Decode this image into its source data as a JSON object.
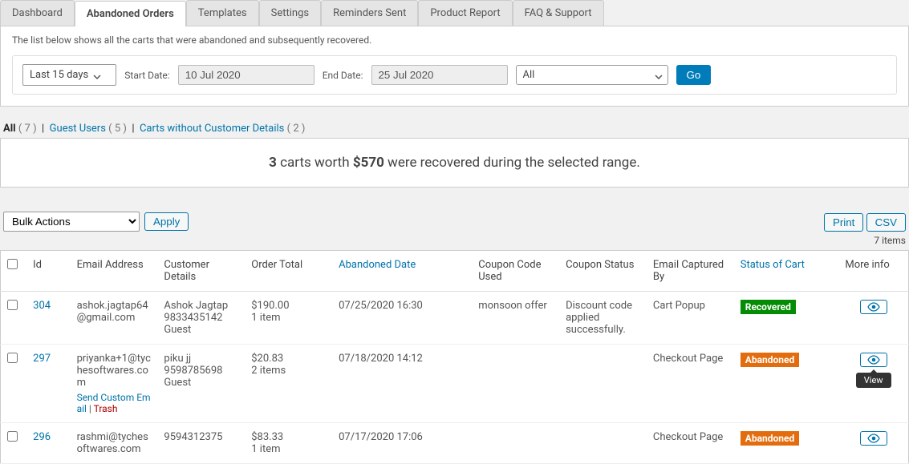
{
  "tabs": [
    "Dashboard",
    "Abandoned Orders",
    "Templates",
    "Settings",
    "Reminders Sent",
    "Product Report",
    "FAQ & Support"
  ],
  "active_tab": "Abandoned Orders",
  "intro": "The list below shows all the carts that were abandoned and subsequently recovered.",
  "filters": {
    "range_label": "Last 15 days",
    "start_label": "Start Date:",
    "start_value": "10 Jul 2020",
    "end_label": "End Date:",
    "end_value": "25 Jul 2020",
    "segment_value": "All",
    "go_label": "Go"
  },
  "subfilters": {
    "all_label": "All",
    "all_count": "( 7 )",
    "guest_label": "Guest Users",
    "guest_count": "( 5 )",
    "nocust_label": "Carts without Customer Details",
    "nocust_count": "( 2 )"
  },
  "summary": {
    "count_bold": "3",
    "mid_text": " carts worth ",
    "amount_bold": "$570",
    "rest": " were recovered during the selected range."
  },
  "actions": {
    "bulk_label": "Bulk Actions",
    "apply_label": "Apply",
    "print_label": "Print",
    "csv_label": "CSV",
    "items_label": "7 items"
  },
  "columns": {
    "cb": "",
    "id": "Id",
    "email": "Email Address",
    "customer": "Customer Details",
    "total": "Order Total",
    "date": "Abandoned Date",
    "coupon_used": "Coupon Code Used",
    "coupon_status": "Coupon Status",
    "captured": "Email Captured By",
    "status": "Status of Cart",
    "more": "More info"
  },
  "rows": [
    {
      "id": "304",
      "email": "ashok.jagtap64@gmail.com",
      "customer_lines": [
        "Ashok Jagtap",
        "9833435142",
        "Guest"
      ],
      "total_lines": [
        "$190.00",
        "1 item"
      ],
      "date": "07/25/2020 16:30",
      "coupon_used": "monsoon offer",
      "coupon_status": "Discount code applied successfully.",
      "captured": "Cart Popup",
      "status": "Recovered",
      "status_class": "recovered",
      "actions": null
    },
    {
      "id": "297",
      "email": "priyanka+1@tychesoftwares.com",
      "customer_lines": [
        "piku jj",
        "9598785698",
        "Guest"
      ],
      "total_lines": [
        "$20.83",
        "2 items"
      ],
      "date": "07/18/2020 14:12",
      "coupon_used": "",
      "coupon_status": "",
      "captured": "Checkout Page",
      "status": "Abandoned",
      "status_class": "abandoned",
      "actions": {
        "send": "Send Custom Email",
        "trash": "Trash"
      },
      "tooltip": "View"
    },
    {
      "id": "296",
      "email": "rashmi@tychesoftwares.com",
      "customer_lines": [
        "",
        "9594312375"
      ],
      "total_lines": [
        "$83.33",
        "1 item"
      ],
      "date": "07/17/2020 17:06",
      "coupon_used": "",
      "coupon_status": "",
      "captured": "Checkout Page",
      "status": "Abandoned",
      "status_class": "abandoned",
      "actions": null
    }
  ]
}
